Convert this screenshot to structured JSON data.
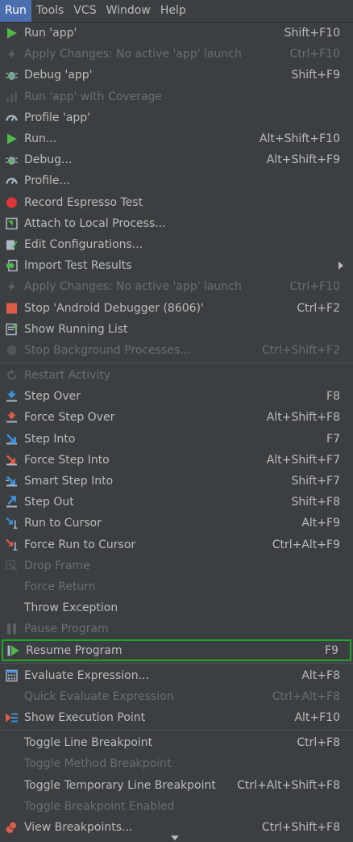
{
  "menubar": [
    "Run",
    "Tools",
    "VCS",
    "Window",
    "Help"
  ],
  "groups": [
    [
      {
        "label": "Run 'app'",
        "shortcut": "Shift+F10",
        "icon": "run-icon"
      },
      {
        "label": "Apply Changes: No active 'app' launch",
        "shortcut": "Ctrl+F10",
        "icon": "apply-changes-icon",
        "disabled": true
      },
      {
        "label": "Debug 'app'",
        "shortcut": "Shift+F9",
        "icon": "debug-icon"
      },
      {
        "label": "Run 'app' with Coverage",
        "shortcut": "",
        "icon": "coverage-icon",
        "disabled": true
      },
      {
        "label": "Profile 'app'",
        "shortcut": "",
        "icon": "profile-icon"
      },
      {
        "label": "Run...",
        "shortcut": "Alt+Shift+F10",
        "icon": "run-icon"
      },
      {
        "label": "Debug...",
        "shortcut": "Alt+Shift+F9",
        "icon": "debug-icon"
      },
      {
        "label": "Profile...",
        "shortcut": "",
        "icon": "profile-icon"
      },
      {
        "label": "Record Espresso Test",
        "shortcut": "",
        "icon": "record-icon"
      },
      {
        "label": "Attach to Local Process...",
        "shortcut": "",
        "icon": "attach-icon"
      },
      {
        "label": "Edit Configurations...",
        "shortcut": "",
        "icon": "edit-config-icon"
      },
      {
        "label": "Import Test Results",
        "shortcut": "",
        "icon": "import-icon",
        "submenu": true
      },
      {
        "label": "Apply Changes: No active 'app' launch",
        "shortcut": "Ctrl+F10",
        "icon": "apply-changes-icon",
        "disabled": true
      },
      {
        "label": "Stop 'Android Debugger (8606)'",
        "shortcut": "Ctrl+F2",
        "icon": "stop-icon"
      },
      {
        "label": "Show Running List",
        "shortcut": "",
        "icon": "running-list-icon"
      },
      {
        "label": "Stop Background Processes...",
        "shortcut": "Ctrl+Shift+F2",
        "icon": "stop-bg-icon",
        "disabled": true
      }
    ],
    [
      {
        "label": "Restart Activity",
        "shortcut": "",
        "icon": "restart-icon",
        "disabled": true
      },
      {
        "label": "Step Over",
        "shortcut": "F8",
        "icon": "step-over-icon"
      },
      {
        "label": "Force Step Over",
        "shortcut": "Alt+Shift+F8",
        "icon": "force-step-over-icon"
      },
      {
        "label": "Step Into",
        "shortcut": "F7",
        "icon": "step-into-icon"
      },
      {
        "label": "Force Step Into",
        "shortcut": "Alt+Shift+F7",
        "icon": "force-step-into-icon"
      },
      {
        "label": "Smart Step Into",
        "shortcut": "Shift+F7",
        "icon": "smart-step-into-icon"
      },
      {
        "label": "Step Out",
        "shortcut": "Shift+F8",
        "icon": "step-out-icon"
      },
      {
        "label": "Run to Cursor",
        "shortcut": "Alt+F9",
        "icon": "run-to-cursor-icon"
      },
      {
        "label": "Force Run to Cursor",
        "shortcut": "Ctrl+Alt+F9",
        "icon": "force-run-to-cursor-icon"
      },
      {
        "label": "Drop Frame",
        "shortcut": "",
        "icon": "drop-frame-icon",
        "disabled": true
      },
      {
        "label": "Force Return",
        "shortcut": "",
        "icon": "",
        "disabled": true
      },
      {
        "label": "Throw Exception",
        "shortcut": "",
        "icon": ""
      },
      {
        "label": "Pause Program",
        "shortcut": "",
        "icon": "pause-icon",
        "disabled": true
      },
      {
        "label": "Resume Program",
        "shortcut": "F9",
        "icon": "resume-icon",
        "highlight": true
      }
    ],
    [
      {
        "label": "Evaluate Expression...",
        "shortcut": "Alt+F8",
        "icon": "evaluate-icon"
      },
      {
        "label": "Quick Evaluate Expression",
        "shortcut": "Ctrl+Alt+F8",
        "icon": "",
        "disabled": true
      },
      {
        "label": "Show Execution Point",
        "shortcut": "Alt+F10",
        "icon": "execution-point-icon"
      }
    ],
    [
      {
        "label": "Toggle Line Breakpoint",
        "shortcut": "Ctrl+F8",
        "icon": ""
      },
      {
        "label": "Toggle Method Breakpoint",
        "shortcut": "",
        "icon": "",
        "disabled": true
      },
      {
        "label": "Toggle Temporary Line Breakpoint",
        "shortcut": "Ctrl+Alt+Shift+F8",
        "icon": ""
      },
      {
        "label": "Toggle Breakpoint Enabled",
        "shortcut": "",
        "icon": "",
        "disabled": true
      },
      {
        "label": "View Breakpoints...",
        "shortcut": "Ctrl+Shift+F8",
        "icon": "breakpoints-icon"
      }
    ]
  ]
}
